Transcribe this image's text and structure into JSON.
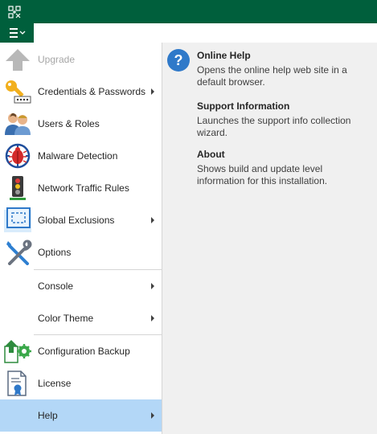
{
  "menu": {
    "items": [
      {
        "label": "Upgrade"
      },
      {
        "label": "Credentials & Passwords"
      },
      {
        "label": "Users & Roles"
      },
      {
        "label": "Malware Detection"
      },
      {
        "label": "Network Traffic Rules"
      },
      {
        "label": "Global Exclusions"
      },
      {
        "label": "Options"
      },
      {
        "label": "Console"
      },
      {
        "label": "Color Theme"
      },
      {
        "label": "Configuration Backup"
      },
      {
        "label": "License"
      },
      {
        "label": "Help"
      }
    ]
  },
  "help": {
    "items": [
      {
        "title": "Online Help",
        "description": "Opens the online help web site in a default browser."
      },
      {
        "title": "Support Information",
        "description": "Launches the support info collection wizard."
      },
      {
        "title": "About",
        "description": "Shows build and update level information for this installation."
      }
    ]
  },
  "colors": {
    "titlebar": "#005f3c",
    "selected": "#b3d7f7",
    "panel": "#f0f0f0"
  },
  "icons": [
    "app-icon",
    "hamburger-icon",
    "upgrade-arrow-icon",
    "key-icon",
    "users-icon",
    "bug-icon",
    "traffic-light-icon",
    "exclusion-icon",
    "tools-icon",
    "backup-icon",
    "license-icon",
    "question-icon"
  ]
}
